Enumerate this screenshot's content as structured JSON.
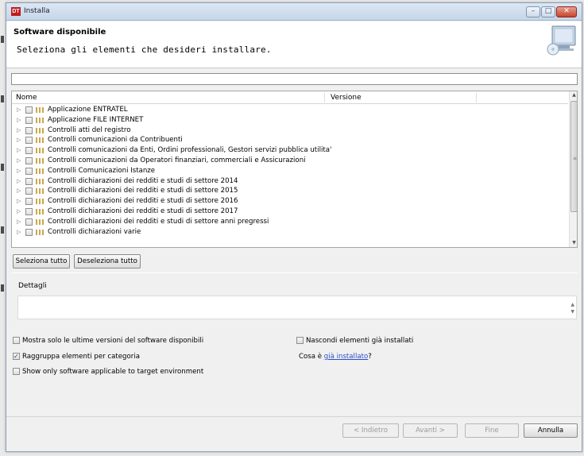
{
  "window": {
    "app_icon_text": "DT",
    "title": "Installa"
  },
  "banner": {
    "title": "Software disponibile",
    "subtitle": "Seleziona gli elementi che desideri installare."
  },
  "filter": {
    "value": "",
    "placeholder": ""
  },
  "tree": {
    "columns": [
      "Nome",
      "Versione"
    ],
    "items": [
      {
        "label": "Applicazione ENTRATEL",
        "checked": false
      },
      {
        "label": "Applicazione FILE INTERNET",
        "checked": false
      },
      {
        "label": "Controlli atti del registro",
        "checked": false
      },
      {
        "label": "Controlli comunicazioni da Contribuenti",
        "checked": false
      },
      {
        "label": "Controlli comunicazioni da Enti, Ordini professionali, Gestori servizi pubblica utilita'",
        "checked": false
      },
      {
        "label": "Controlli comunicazioni da Operatori finanziari, commerciali e Assicurazioni",
        "checked": false
      },
      {
        "label": "Controlli Comunicazioni Istanze",
        "checked": false
      },
      {
        "label": "Controlli dichiarazioni dei redditi e studi di settore 2014",
        "checked": false
      },
      {
        "label": "Controlli dichiarazioni dei redditi e studi di settore 2015",
        "checked": false
      },
      {
        "label": "Controlli dichiarazioni dei redditi e studi di settore 2016",
        "checked": false
      },
      {
        "label": "Controlli dichiarazioni dei redditi e studi di settore 2017",
        "checked": false
      },
      {
        "label": "Controlli dichiarazioni dei redditi e studi di settore anni pregressi",
        "checked": false
      },
      {
        "label": "Controlli dichiarazioni varie",
        "checked": false
      }
    ]
  },
  "buttons": {
    "select_all": "Seleziona tutto",
    "deselect_all": "Deseleziona tutto",
    "back": "< Indietro",
    "next": "Avanti >",
    "finish": "Fine",
    "cancel": "Annulla"
  },
  "details": {
    "label": "Dettagli",
    "text": ""
  },
  "options": {
    "latest_only": {
      "label": "Mostra solo le ultime versioni del software disponibili",
      "checked": false
    },
    "group_by_category": {
      "label": "Raggruppa elementi per categoria",
      "checked": true
    },
    "target_env_only": {
      "label": "Show only software applicable to target environment",
      "checked": false
    },
    "hide_installed": {
      "label": "Nascondi elementi già installati",
      "checked": false
    }
  },
  "installed_note": {
    "prefix": "Cosa è ",
    "link": "già installato",
    "suffix": "?"
  },
  "icons": {
    "app": "application-icon",
    "monitor": "monitor-cd-icon",
    "expander": "expand-arrow-icon",
    "package": "package-icon"
  }
}
